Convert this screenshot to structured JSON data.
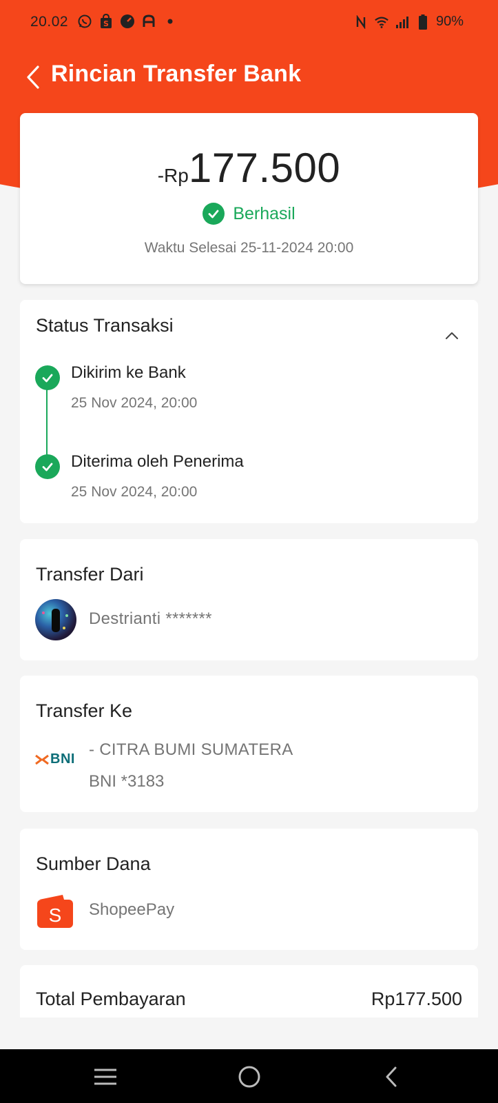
{
  "status_bar": {
    "time": "20.02",
    "battery": "90%",
    "icons": [
      "whatsapp-icon",
      "shopee-bag-icon",
      "gauge-icon",
      "app-a-icon",
      "dot-icon",
      "nfc-icon",
      "wifi-icon",
      "signal-icon",
      "battery-icon"
    ]
  },
  "header": {
    "title": "Rincian Transfer Bank"
  },
  "summary": {
    "amount_prefix": "-Rp",
    "amount": "177.500",
    "status": "Berhasil",
    "finish_time": "Waktu Selesai 25-11-2024 20:00"
  },
  "transaction_status": {
    "title": "Status Transaksi",
    "steps": [
      {
        "label": "Dikirim ke Bank",
        "time": "25 Nov 2024, 20:00"
      },
      {
        "label": "Diterima oleh Penerima",
        "time": "25 Nov 2024, 20:00"
      }
    ]
  },
  "transfer_from": {
    "title": "Transfer Dari",
    "name": "Destrianti *******"
  },
  "transfer_to": {
    "title": "Transfer Ke",
    "bank_logo_text": "BNI",
    "recipient": "- CITRA BUMI SUMATERA",
    "account": "BNI *3183"
  },
  "source_of_funds": {
    "title": "Sumber Dana",
    "name": "ShopeePay"
  },
  "total": {
    "label": "Total Pembayaran",
    "value": "Rp177.500"
  },
  "colors": {
    "brand_orange": "#f5461b",
    "success_green": "#1aa85a",
    "bni_teal": "#0d6e78",
    "bni_orange": "#f06a22"
  }
}
